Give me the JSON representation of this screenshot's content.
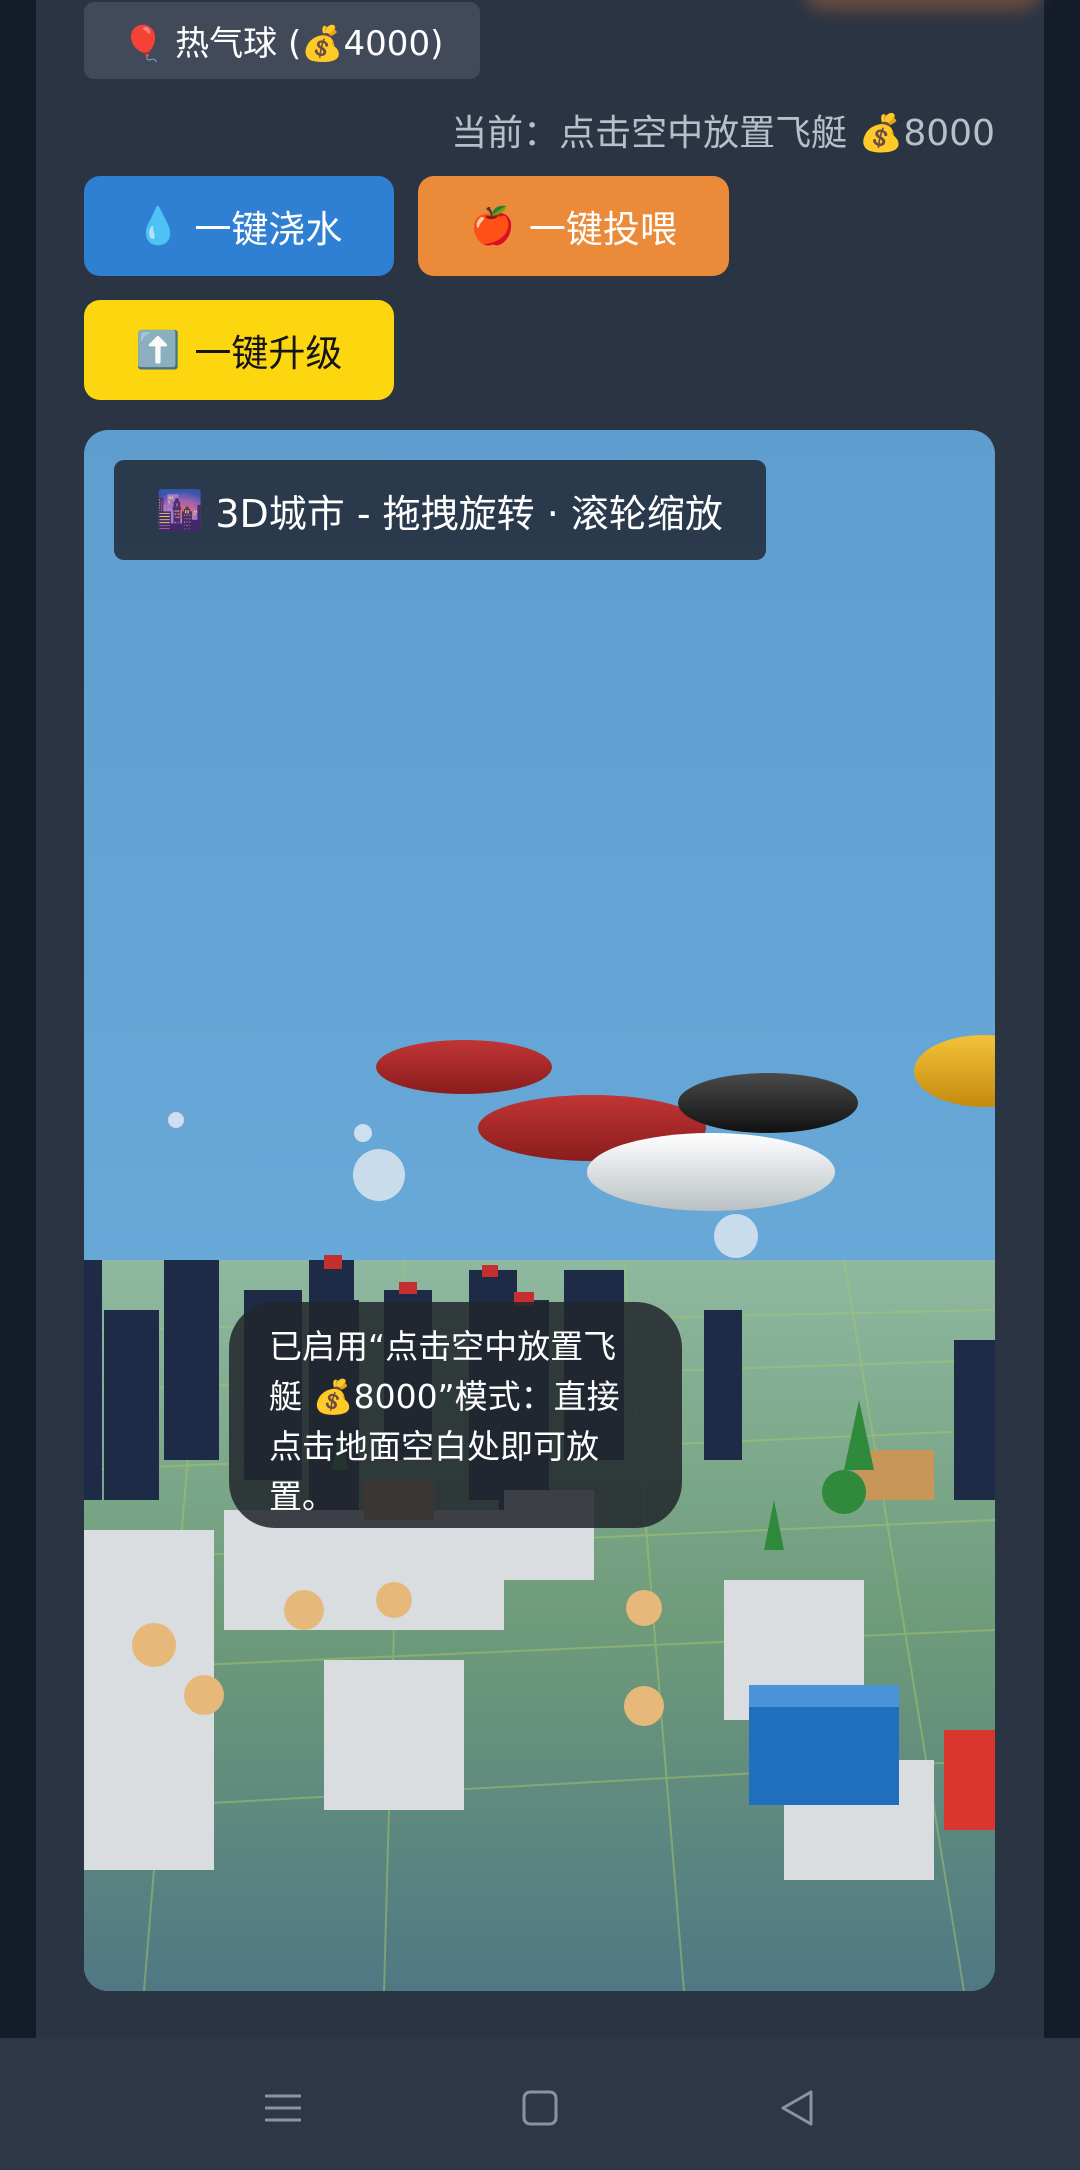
{
  "header": {
    "balloon_button": "🎈 热气球 (💰4000)",
    "current_mode": "当前：点击空中放置飞艇 💰8000"
  },
  "actions": {
    "water": {
      "icon": "💧",
      "label": "一键浇水"
    },
    "feed": {
      "icon": "🍎",
      "label": "一键投喂"
    },
    "upgrade": {
      "icon": "⬆️",
      "label": "一键升级"
    }
  },
  "scene": {
    "label_icon": "🌆",
    "label": "3D城市 - 拖拽旋转 · 滚轮缩放",
    "toast": "已启用“点击空中放置飞艇 💰8000”模式：直接点击地面空白处即可放置。"
  },
  "nav": {
    "icons": [
      "menu-icon",
      "home-icon",
      "back-icon"
    ]
  },
  "colors": {
    "water": "#2f7fd3",
    "feed": "#eb8a39",
    "upgrade": "#fcd710",
    "panel": "#2b3443"
  }
}
